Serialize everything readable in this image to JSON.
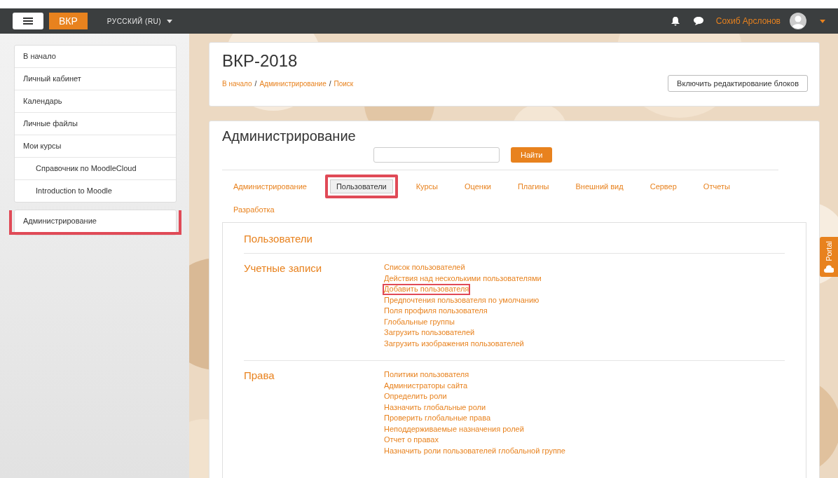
{
  "navbar": {
    "brand": "ВКР",
    "language": "РУССКИЙ (RU)",
    "user_name": "Сохиб Арслонов"
  },
  "sidebar": {
    "items": [
      {
        "label": "В начало",
        "highlighted": false
      },
      {
        "label": "Личный кабинет",
        "highlighted": false
      },
      {
        "label": "Календарь",
        "highlighted": false
      },
      {
        "label": "Личные файлы",
        "highlighted": false
      },
      {
        "label": "Мои курсы",
        "highlighted": false,
        "children": [
          {
            "label": "Справочник по MoodleCloud",
            "highlighted": false
          },
          {
            "label": "Introduction to Moodle",
            "highlighted": false
          }
        ]
      }
    ],
    "admin_items": [
      {
        "label": "Администрирование",
        "highlighted": true
      }
    ]
  },
  "header": {
    "title": "ВКР-2018",
    "breadcrumb": [
      "В начало",
      "Администрирование",
      "Поиск"
    ],
    "breadcrumb_separator": "/",
    "edit_button": "Включить редактирование блоков"
  },
  "admin": {
    "title": "Администрирование",
    "search_button": "Найти",
    "tabs": [
      {
        "label": "Администрирование",
        "selected": false,
        "highlighted": false
      },
      {
        "label": "Пользователи",
        "selected": true,
        "highlighted": true
      },
      {
        "label": "Курсы",
        "selected": false,
        "highlighted": false
      },
      {
        "label": "Оценки",
        "selected": false,
        "highlighted": false
      },
      {
        "label": "Плагины",
        "selected": false,
        "highlighted": false
      },
      {
        "label": "Внешний вид",
        "selected": false,
        "highlighted": false
      },
      {
        "label": "Сервер",
        "selected": false,
        "highlighted": false
      },
      {
        "label": "Отчеты",
        "selected": false,
        "highlighted": false
      },
      {
        "label": "Разработка",
        "selected": false,
        "highlighted": false
      }
    ],
    "section_title": "Пользователи",
    "groups": [
      {
        "title": "Учетные записи",
        "links": [
          {
            "label": "Список пользователей",
            "highlighted": false
          },
          {
            "label": "Действия над несколькими пользователями",
            "highlighted": false
          },
          {
            "label": "Добавить пользователя",
            "highlighted": true
          },
          {
            "label": "Предпочтения пользователя по умолчанию",
            "highlighted": false
          },
          {
            "label": "Поля профиля пользователя",
            "highlighted": false
          },
          {
            "label": "Глобальные группы",
            "highlighted": false
          },
          {
            "label": "Загрузить пользователей",
            "highlighted": false
          },
          {
            "label": "Загрузить изображения пользователей",
            "highlighted": false
          }
        ]
      },
      {
        "title": "Права",
        "links": [
          {
            "label": "Политики пользователя",
            "highlighted": false
          },
          {
            "label": "Администраторы сайта",
            "highlighted": false
          },
          {
            "label": "Определить роли",
            "highlighted": false
          },
          {
            "label": "Назначить глобальные роли",
            "highlighted": false
          },
          {
            "label": "Проверить глобальные права",
            "highlighted": false
          },
          {
            "label": "Неподдерживаемые назначения ролей",
            "highlighted": false
          },
          {
            "label": "Отчет о правах",
            "highlighted": false
          },
          {
            "label": "Назначить роли пользователей глобальной группе",
            "highlighted": false
          }
        ]
      }
    ]
  },
  "portal_tab": "Portal"
}
